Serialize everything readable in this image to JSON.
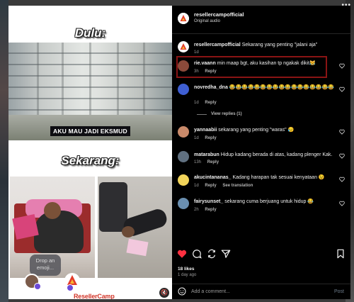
{
  "post": {
    "username": "resellercampofficial",
    "audio": "Original audio"
  },
  "media": {
    "title_top": "Dulu:",
    "caption_top": "AKU MAU JADI EKSMUD",
    "title_bottom": "Sekarang:",
    "emoji_prompt": "Drop an emoji...",
    "brand": "ResellerCamp",
    "mute_icon": "speaker-muted-icon"
  },
  "comments": [
    {
      "username": "resellercampofficial",
      "text": "Sekarang yang penting \"jalani aja\"",
      "meta": [
        "1d"
      ],
      "avatar_color": "#ffffff"
    },
    {
      "username": "rie.vaann",
      "text": "min maap bgt, aku kasihan tp ngakak dikit😹",
      "meta": [
        "3h",
        "Reply"
      ],
      "avatar_color": "#8b4a3a"
    },
    {
      "username": "novredha_dna",
      "text": "😂😂😂😂😂😂😂😂😂😂😂😂😂😂😂😂😂",
      "meta": [
        "1d",
        "Reply"
      ],
      "avatar_color": "#3f5fd3",
      "view_replies": "View replies (1)"
    },
    {
      "username": "yannaabii",
      "text": "sekarang yang penting \"waras\" 😥",
      "meta": [
        "1d",
        "Reply"
      ],
      "avatar_color": "#c98a6a"
    },
    {
      "username": "matarabun",
      "text": "Hidup kadang berada di atas, kadang plenger Kak.",
      "meta": [
        "13h",
        "Reply"
      ],
      "avatar_color": "#607080"
    },
    {
      "username": "akucintananas_",
      "text": "Kadang harapan tak sesuai kenyataan 😉",
      "meta": [
        "1d",
        "Reply",
        "See translation"
      ],
      "avatar_color": "#f2d45a"
    },
    {
      "username": "fairysunset_",
      "text": "sekarang cuma berjuang untuk hidup 😂",
      "meta": [
        "2h",
        "Reply"
      ],
      "avatar_color": "#6a8fb0"
    }
  ],
  "actions": {
    "likes": "18 likes",
    "time_ago": "1 day ago",
    "add_comment_placeholder": "Add a comment...",
    "post_label": "Post",
    "like_color": "#ff3040"
  }
}
